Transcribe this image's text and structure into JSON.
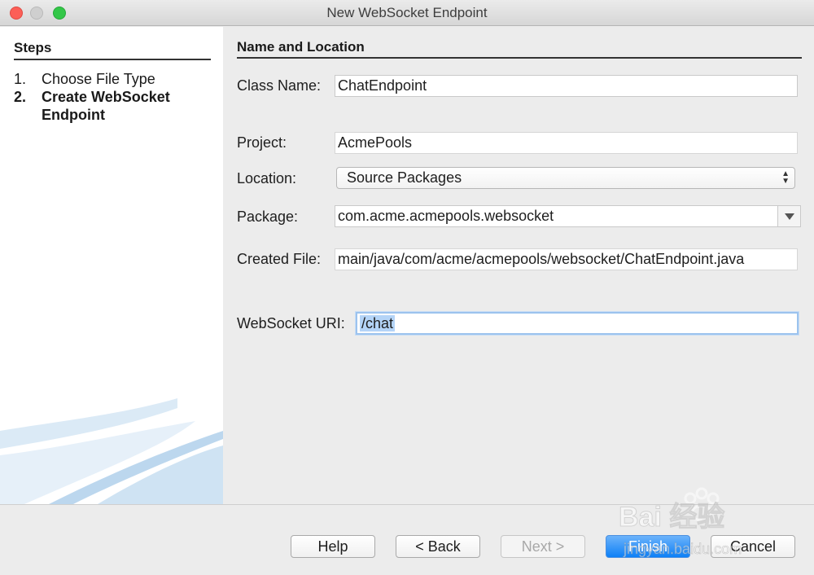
{
  "window": {
    "title": "New WebSocket Endpoint"
  },
  "steps": {
    "heading": "Steps",
    "items": [
      {
        "num": "1.",
        "label": "Choose File Type"
      },
      {
        "num": "2.",
        "label": "Create WebSocket Endpoint"
      }
    ]
  },
  "form": {
    "section_title": "Name and Location",
    "class_name": {
      "label": "Class Name:",
      "value": "ChatEndpoint"
    },
    "project": {
      "label": "Project:",
      "value": "AcmePools"
    },
    "location": {
      "label": "Location:",
      "value": "Source Packages"
    },
    "package": {
      "label": "Package:",
      "value": "com.acme.acmepools.websocket"
    },
    "created_file": {
      "label": "Created File:",
      "value": "main/java/com/acme/acmepools/websocket/ChatEndpoint.java"
    },
    "websocket_uri": {
      "label": "WebSocket URI:",
      "value": "/chat"
    }
  },
  "buttons": {
    "help": "Help",
    "back": "< Back",
    "next": "Next >",
    "finish": "Finish",
    "cancel": "Cancel"
  },
  "colors": {
    "primary_button": "#1a86f8",
    "focus_ring": "#9cc3ee",
    "close": "#fc5f57",
    "maximize": "#33c748"
  },
  "watermark": {
    "text": "Bai 经验",
    "subtext": "jingyan.baidu.com"
  }
}
